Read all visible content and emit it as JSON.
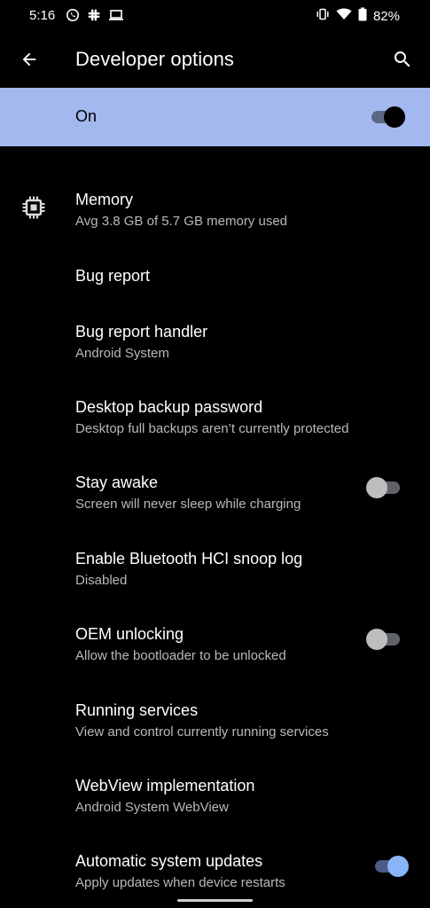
{
  "status_bar": {
    "time": "5:16",
    "battery": "82%",
    "left_icons": [
      "whatsapp-icon",
      "slack-icon",
      "laptop-icon"
    ],
    "right_icons": [
      "vibrate-icon",
      "wifi-icon",
      "battery-icon"
    ]
  },
  "app_bar": {
    "title": "Developer options"
  },
  "master_switch": {
    "label": "On",
    "checked": true,
    "background": "#a2b8ee"
  },
  "settings": [
    {
      "title": "Memory",
      "summary": "Avg 3.8 GB of 5.7 GB memory used",
      "icon": "memory-chip-icon"
    },
    {
      "title": "Bug report"
    },
    {
      "title": "Bug report handler",
      "summary": "Android System"
    },
    {
      "title": "Desktop backup password",
      "summary": "Desktop full backups aren’t currently protected"
    },
    {
      "title": "Stay awake",
      "summary": "Screen will never sleep while charging",
      "toggle": false
    },
    {
      "title": "Enable Bluetooth HCI snoop log",
      "summary": "Disabled"
    },
    {
      "title": "OEM unlocking",
      "summary": "Allow the bootloader to be unlocked",
      "toggle": false
    },
    {
      "title": "Running services",
      "summary": "View and control currently running services"
    },
    {
      "title": "WebView implementation",
      "summary": "Android System WebView"
    },
    {
      "title": "Automatic system updates",
      "summary": "Apply updates when device restarts",
      "toggle": true
    }
  ],
  "colors": {
    "background": "#000000",
    "accent": "#8ab4f8",
    "summary_text": "#b9b9b9"
  }
}
